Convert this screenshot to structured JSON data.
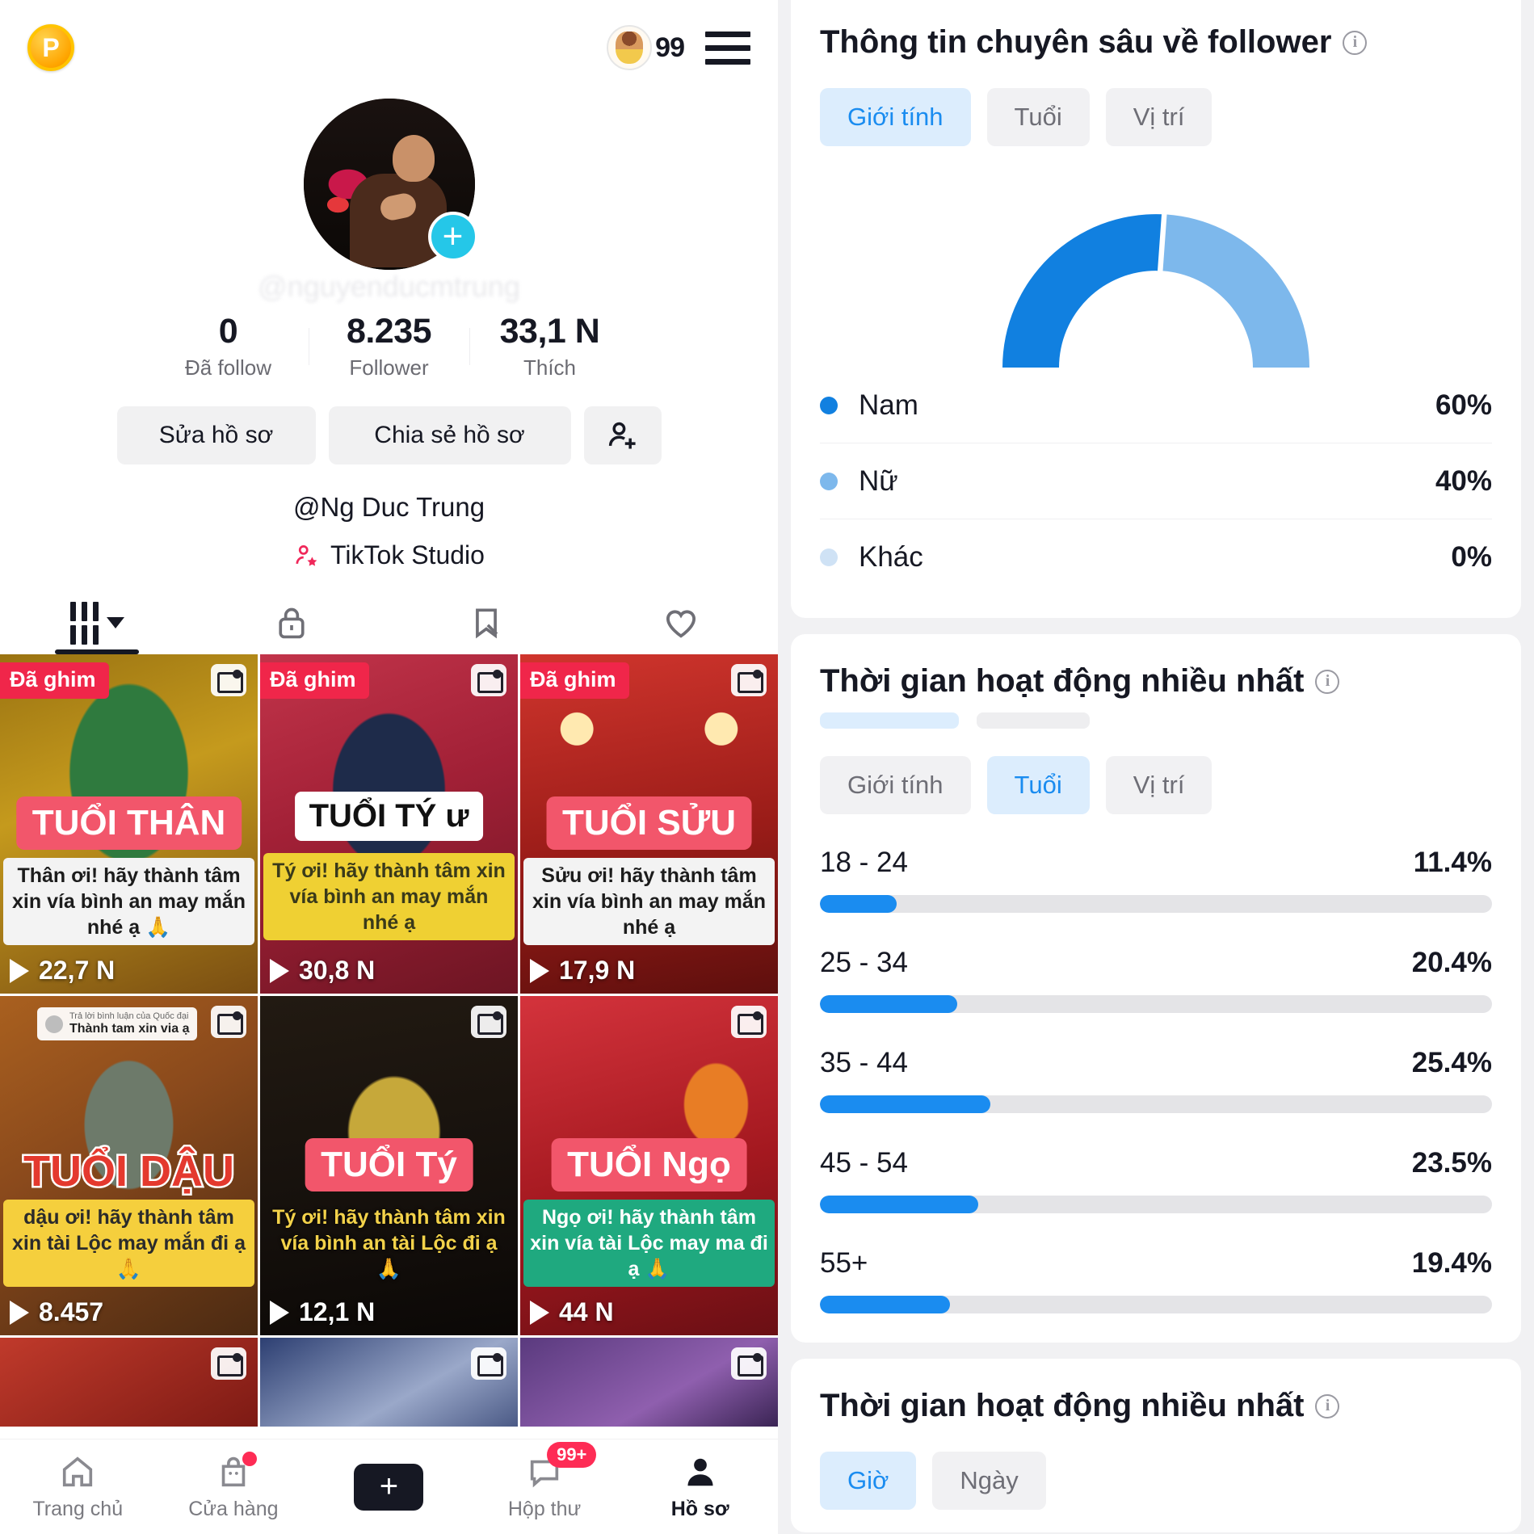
{
  "left": {
    "topbar": {
      "coin_label": "P",
      "avatar_badge_count": "99",
      "menu_icon": "hamburger-icon"
    },
    "profile": {
      "add_icon": "plus-icon",
      "handle": "@Ng Duc Trung",
      "studio_label": "TikTok Studio",
      "stats": [
        {
          "num": "0",
          "label": "Đã follow"
        },
        {
          "num": "8.235",
          "label": "Follower"
        },
        {
          "num": "33,1 N",
          "label": "Thích"
        }
      ],
      "buttons": {
        "edit": "Sửa hồ sơ",
        "share": "Chia sẻ hồ sơ",
        "add_person_icon": "person-add-icon"
      }
    },
    "tabs": [
      {
        "icon": "grid-videos-icon",
        "active": true
      },
      {
        "icon": "lock-icon",
        "active": false
      },
      {
        "icon": "bookmark-off-icon",
        "active": false
      },
      {
        "icon": "heart-icon",
        "active": false
      }
    ],
    "videos": [
      {
        "pin": "Đã ghim",
        "title": "TUỔI THÂN",
        "caption": "Thân ơi! hãy thành tâm xin vía bình an may mắn nhé ạ 🙏",
        "views": "22,7 N",
        "multi": true
      },
      {
        "pin": "Đã ghim",
        "title": "TUỔI TÝ ư",
        "caption": "Tý ơi! hãy thành tâm xin vía bình an may mắn nhé ạ",
        "views": "30,8 N",
        "multi": true
      },
      {
        "pin": "Đã ghim",
        "title": "TUỔI SỬU",
        "caption": "Sửu ơi! hãy thành tâm xin vía bình an may mắn nhé ạ",
        "views": "17,9 N",
        "multi": true
      },
      {
        "pin": "",
        "title": "TUỔI DẬU",
        "caption": "dậu ơi! hãy thành tâm xin tài Lộc may mắn đi ạ 🙏",
        "views": "8.457",
        "multi": true,
        "reply_title": "Thành tam xin via ạ",
        "reply_sub": "Trả lời bình luận của Quốc đại"
      },
      {
        "pin": "",
        "title": "TUỔI Tý",
        "caption": "Tý ơi! hãy thành tâm xin vía bình an tài Lộc đi ạ 🙏",
        "views": "12,1 N",
        "multi": true
      },
      {
        "pin": "",
        "title": "TUỔI Ngọ",
        "caption": "Ngọ ơi! hãy thành tâm xin vía tài Lộc may ma đi ạ 🙏",
        "views": "44 N",
        "multi": true
      }
    ],
    "bottom_nav": [
      {
        "icon": "home-icon",
        "label": "Trang chủ",
        "active": false,
        "dot": false,
        "badge": ""
      },
      {
        "icon": "shop-bag-icon",
        "label": "Cửa hàng",
        "active": false,
        "dot": true,
        "badge": ""
      },
      {
        "icon": "create-plus-icon",
        "label": "",
        "active": false,
        "dot": false,
        "badge": ""
      },
      {
        "icon": "inbox-icon",
        "label": "Hộp thư",
        "active": false,
        "dot": false,
        "badge": "99+"
      },
      {
        "icon": "profile-person-icon",
        "label": "Hồ sơ",
        "active": true,
        "dot": false,
        "badge": ""
      }
    ]
  },
  "right": {
    "follower_card": {
      "title": "Thông tin chuyên sâu về follower",
      "info_icon": "info-icon",
      "tabs": [
        {
          "label": "Giới tính",
          "active": true
        },
        {
          "label": "Tuổi",
          "active": false
        },
        {
          "label": "Vị trí",
          "active": false
        }
      ]
    },
    "age_card": {
      "title": "Thời gian hoạt động nhiều nhất",
      "info_icon": "info-icon",
      "tabs": [
        {
          "label": "Giới tính",
          "active": false
        },
        {
          "label": "Tuổi",
          "active": true
        },
        {
          "label": "Vị trí",
          "active": false
        }
      ]
    },
    "time_card": {
      "title": "Thời gian hoạt động nhiều nhất",
      "info_icon": "info-icon",
      "tabs": [
        {
          "label": "Giờ",
          "active": true
        },
        {
          "label": "Ngày",
          "active": false
        }
      ]
    }
  },
  "chart_data": [
    {
      "type": "pie",
      "title": "Thông tin chuyên sâu về follower",
      "subtitle": "Giới tính",
      "legend_position": "below",
      "labels": [
        "Nam",
        "Nữ",
        "Khác"
      ],
      "values": [
        60,
        40,
        0
      ],
      "value_labels": [
        "60%",
        "40%",
        "0%"
      ],
      "colors": [
        "#1180e0",
        "#7db8ec",
        "#cfe2f5"
      ],
      "note": "semicircle donut gauge"
    },
    {
      "type": "bar",
      "title": "Thời gian hoạt động nhiều nhất",
      "subtitle": "Tuổi",
      "orientation": "horizontal",
      "categories": [
        "18 - 24",
        "25 - 34",
        "35 - 44",
        "45 - 54",
        "55+"
      ],
      "values": [
        11.4,
        20.4,
        25.4,
        23.5,
        19.4
      ],
      "value_labels": [
        "11.4%",
        "20.4%",
        "25.4%",
        "23.5%",
        "19.4%"
      ],
      "xlabel": "",
      "ylabel": "",
      "xlim": [
        0,
        100
      ],
      "grid": false,
      "bar_color": "#1a8cf0",
      "track_color": "#e4e4e7"
    }
  ]
}
